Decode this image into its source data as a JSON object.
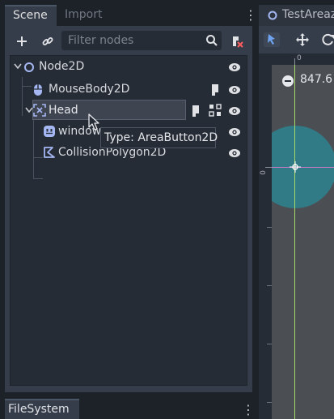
{
  "scene_dock": {
    "tabs": [
      {
        "label": "Scene"
      },
      {
        "label": "Import"
      }
    ],
    "filter": {
      "placeholder": "Filter nodes"
    },
    "tree": {
      "nodes": [
        {
          "label": "Node2D",
          "icon": "node2d-circle-icon"
        },
        {
          "label": "MouseBody2D",
          "icon": "mouse-icon"
        },
        {
          "label": "Head",
          "icon": "area-button-icon"
        },
        {
          "label": "window",
          "icon": "sprite-face-icon"
        },
        {
          "label": "CollisionPolygon2D",
          "icon": "collision-polygon-icon"
        }
      ]
    },
    "tooltip": "Type: AreaButton2D"
  },
  "filesystem_dock": {
    "tab_label": "FileSystem"
  },
  "viewport": {
    "tab_label": "TestAreaz",
    "zoom_value": "847.6",
    "ruler_top_zero": "0",
    "ruler_left_zero": "0"
  },
  "colors": {
    "panel": "#363d4a",
    "tree_bg": "#262c35",
    "accent_blue": "#6fa3f0",
    "canvas": "#4b4f53",
    "area_shape": "#2f7f8c"
  }
}
